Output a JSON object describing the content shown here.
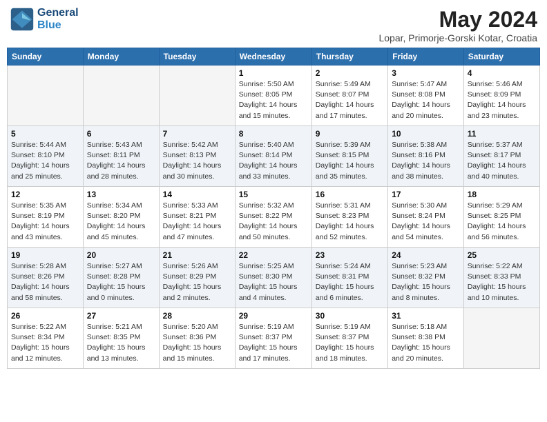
{
  "header": {
    "logo_line1": "General",
    "logo_line2": "Blue",
    "month_year": "May 2024",
    "location": "Lopar, Primorje-Gorski Kotar, Croatia"
  },
  "days_of_week": [
    "Sunday",
    "Monday",
    "Tuesday",
    "Wednesday",
    "Thursday",
    "Friday",
    "Saturday"
  ],
  "weeks": [
    [
      {
        "day": "",
        "info": ""
      },
      {
        "day": "",
        "info": ""
      },
      {
        "day": "",
        "info": ""
      },
      {
        "day": "1",
        "info": "Sunrise: 5:50 AM\nSunset: 8:05 PM\nDaylight: 14 hours\nand 15 minutes."
      },
      {
        "day": "2",
        "info": "Sunrise: 5:49 AM\nSunset: 8:07 PM\nDaylight: 14 hours\nand 17 minutes."
      },
      {
        "day": "3",
        "info": "Sunrise: 5:47 AM\nSunset: 8:08 PM\nDaylight: 14 hours\nand 20 minutes."
      },
      {
        "day": "4",
        "info": "Sunrise: 5:46 AM\nSunset: 8:09 PM\nDaylight: 14 hours\nand 23 minutes."
      }
    ],
    [
      {
        "day": "5",
        "info": "Sunrise: 5:44 AM\nSunset: 8:10 PM\nDaylight: 14 hours\nand 25 minutes."
      },
      {
        "day": "6",
        "info": "Sunrise: 5:43 AM\nSunset: 8:11 PM\nDaylight: 14 hours\nand 28 minutes."
      },
      {
        "day": "7",
        "info": "Sunrise: 5:42 AM\nSunset: 8:13 PM\nDaylight: 14 hours\nand 30 minutes."
      },
      {
        "day": "8",
        "info": "Sunrise: 5:40 AM\nSunset: 8:14 PM\nDaylight: 14 hours\nand 33 minutes."
      },
      {
        "day": "9",
        "info": "Sunrise: 5:39 AM\nSunset: 8:15 PM\nDaylight: 14 hours\nand 35 minutes."
      },
      {
        "day": "10",
        "info": "Sunrise: 5:38 AM\nSunset: 8:16 PM\nDaylight: 14 hours\nand 38 minutes."
      },
      {
        "day": "11",
        "info": "Sunrise: 5:37 AM\nSunset: 8:17 PM\nDaylight: 14 hours\nand 40 minutes."
      }
    ],
    [
      {
        "day": "12",
        "info": "Sunrise: 5:35 AM\nSunset: 8:19 PM\nDaylight: 14 hours\nand 43 minutes."
      },
      {
        "day": "13",
        "info": "Sunrise: 5:34 AM\nSunset: 8:20 PM\nDaylight: 14 hours\nand 45 minutes."
      },
      {
        "day": "14",
        "info": "Sunrise: 5:33 AM\nSunset: 8:21 PM\nDaylight: 14 hours\nand 47 minutes."
      },
      {
        "day": "15",
        "info": "Sunrise: 5:32 AM\nSunset: 8:22 PM\nDaylight: 14 hours\nand 50 minutes."
      },
      {
        "day": "16",
        "info": "Sunrise: 5:31 AM\nSunset: 8:23 PM\nDaylight: 14 hours\nand 52 minutes."
      },
      {
        "day": "17",
        "info": "Sunrise: 5:30 AM\nSunset: 8:24 PM\nDaylight: 14 hours\nand 54 minutes."
      },
      {
        "day": "18",
        "info": "Sunrise: 5:29 AM\nSunset: 8:25 PM\nDaylight: 14 hours\nand 56 minutes."
      }
    ],
    [
      {
        "day": "19",
        "info": "Sunrise: 5:28 AM\nSunset: 8:26 PM\nDaylight: 14 hours\nand 58 minutes."
      },
      {
        "day": "20",
        "info": "Sunrise: 5:27 AM\nSunset: 8:28 PM\nDaylight: 15 hours\nand 0 minutes."
      },
      {
        "day": "21",
        "info": "Sunrise: 5:26 AM\nSunset: 8:29 PM\nDaylight: 15 hours\nand 2 minutes."
      },
      {
        "day": "22",
        "info": "Sunrise: 5:25 AM\nSunset: 8:30 PM\nDaylight: 15 hours\nand 4 minutes."
      },
      {
        "day": "23",
        "info": "Sunrise: 5:24 AM\nSunset: 8:31 PM\nDaylight: 15 hours\nand 6 minutes."
      },
      {
        "day": "24",
        "info": "Sunrise: 5:23 AM\nSunset: 8:32 PM\nDaylight: 15 hours\nand 8 minutes."
      },
      {
        "day": "25",
        "info": "Sunrise: 5:22 AM\nSunset: 8:33 PM\nDaylight: 15 hours\nand 10 minutes."
      }
    ],
    [
      {
        "day": "26",
        "info": "Sunrise: 5:22 AM\nSunset: 8:34 PM\nDaylight: 15 hours\nand 12 minutes."
      },
      {
        "day": "27",
        "info": "Sunrise: 5:21 AM\nSunset: 8:35 PM\nDaylight: 15 hours\nand 13 minutes."
      },
      {
        "day": "28",
        "info": "Sunrise: 5:20 AM\nSunset: 8:36 PM\nDaylight: 15 hours\nand 15 minutes."
      },
      {
        "day": "29",
        "info": "Sunrise: 5:19 AM\nSunset: 8:37 PM\nDaylight: 15 hours\nand 17 minutes."
      },
      {
        "day": "30",
        "info": "Sunrise: 5:19 AM\nSunset: 8:37 PM\nDaylight: 15 hours\nand 18 minutes."
      },
      {
        "day": "31",
        "info": "Sunrise: 5:18 AM\nSunset: 8:38 PM\nDaylight: 15 hours\nand 20 minutes."
      },
      {
        "day": "",
        "info": ""
      }
    ]
  ]
}
